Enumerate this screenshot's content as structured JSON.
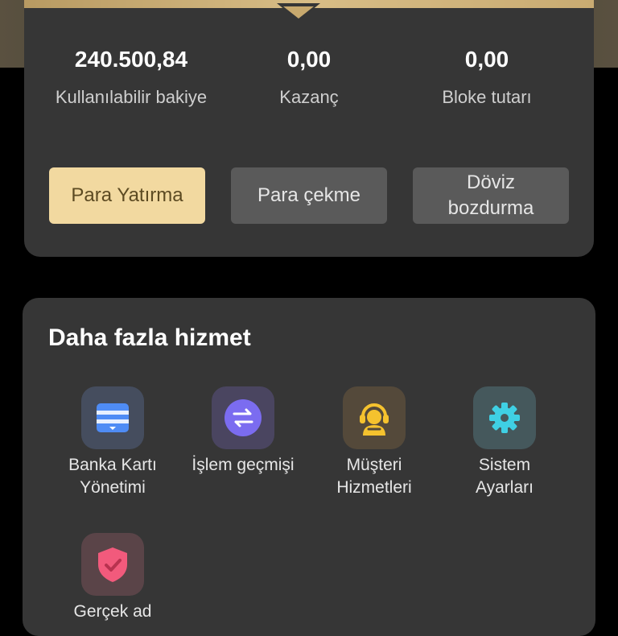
{
  "balance": {
    "stats": [
      {
        "value": "240.500,84",
        "label": "Kullanılabilir bakiye"
      },
      {
        "value": "0,00",
        "label": "Kazanç"
      },
      {
        "value": "0,00",
        "label": "Bloke tutarı"
      }
    ],
    "actions": [
      {
        "label": "Para Yatırma"
      },
      {
        "label": "Para çekme"
      },
      {
        "label": "Döviz\nbozdurma"
      }
    ]
  },
  "services": {
    "title": "Daha fazla hizmet",
    "items": [
      {
        "label": "Banka Kartı\nYönetimi",
        "icon": "bank-card-icon",
        "color": "#4f8cf5"
      },
      {
        "label": "İşlem geçmişi",
        "icon": "exchange-arrows-icon",
        "color": "#7b6cf0"
      },
      {
        "label": "Müşteri\nHizmetleri",
        "icon": "customer-service-icon",
        "color": "#f5c22e"
      },
      {
        "label": "Sistem\nAyarları",
        "icon": "gear-icon",
        "color": "#3fd0e4"
      },
      {
        "label": "Gerçek ad",
        "icon": "shield-check-icon",
        "color": "#f25a7c"
      }
    ]
  },
  "colors": {
    "accent_gold": "#f2d9a0",
    "card_bg": "#363636",
    "page_bg": "#000000"
  }
}
